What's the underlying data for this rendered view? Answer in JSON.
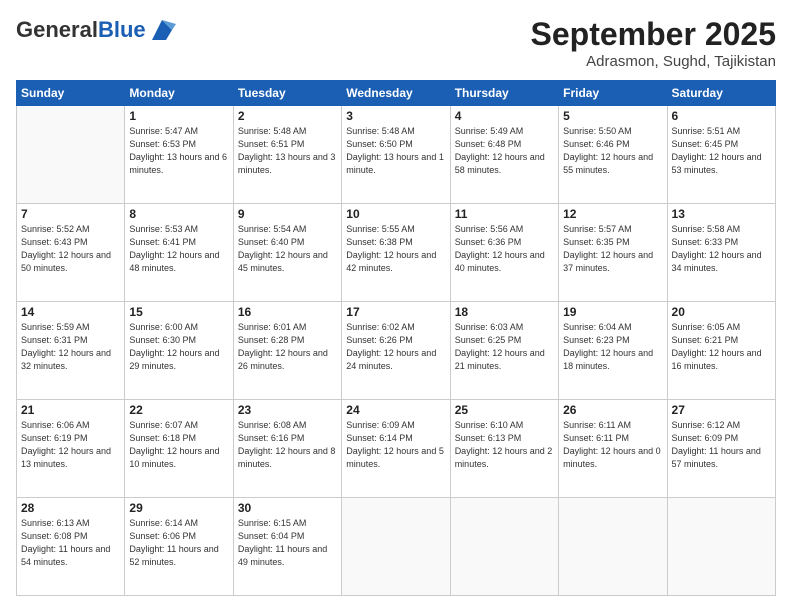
{
  "logo": {
    "general": "General",
    "blue": "Blue"
  },
  "header": {
    "month": "September 2025",
    "location": "Adrasmon, Sughd, Tajikistan"
  },
  "weekdays": [
    "Sunday",
    "Monday",
    "Tuesday",
    "Wednesday",
    "Thursday",
    "Friday",
    "Saturday"
  ],
  "weeks": [
    [
      {
        "day": "",
        "sunrise": "",
        "sunset": "",
        "daylight": ""
      },
      {
        "day": "1",
        "sunrise": "Sunrise: 5:47 AM",
        "sunset": "Sunset: 6:53 PM",
        "daylight": "Daylight: 13 hours and 6 minutes."
      },
      {
        "day": "2",
        "sunrise": "Sunrise: 5:48 AM",
        "sunset": "Sunset: 6:51 PM",
        "daylight": "Daylight: 13 hours and 3 minutes."
      },
      {
        "day": "3",
        "sunrise": "Sunrise: 5:48 AM",
        "sunset": "Sunset: 6:50 PM",
        "daylight": "Daylight: 13 hours and 1 minute."
      },
      {
        "day": "4",
        "sunrise": "Sunrise: 5:49 AM",
        "sunset": "Sunset: 6:48 PM",
        "daylight": "Daylight: 12 hours and 58 minutes."
      },
      {
        "day": "5",
        "sunrise": "Sunrise: 5:50 AM",
        "sunset": "Sunset: 6:46 PM",
        "daylight": "Daylight: 12 hours and 55 minutes."
      },
      {
        "day": "6",
        "sunrise": "Sunrise: 5:51 AM",
        "sunset": "Sunset: 6:45 PM",
        "daylight": "Daylight: 12 hours and 53 minutes."
      }
    ],
    [
      {
        "day": "7",
        "sunrise": "Sunrise: 5:52 AM",
        "sunset": "Sunset: 6:43 PM",
        "daylight": "Daylight: 12 hours and 50 minutes."
      },
      {
        "day": "8",
        "sunrise": "Sunrise: 5:53 AM",
        "sunset": "Sunset: 6:41 PM",
        "daylight": "Daylight: 12 hours and 48 minutes."
      },
      {
        "day": "9",
        "sunrise": "Sunrise: 5:54 AM",
        "sunset": "Sunset: 6:40 PM",
        "daylight": "Daylight: 12 hours and 45 minutes."
      },
      {
        "day": "10",
        "sunrise": "Sunrise: 5:55 AM",
        "sunset": "Sunset: 6:38 PM",
        "daylight": "Daylight: 12 hours and 42 minutes."
      },
      {
        "day": "11",
        "sunrise": "Sunrise: 5:56 AM",
        "sunset": "Sunset: 6:36 PM",
        "daylight": "Daylight: 12 hours and 40 minutes."
      },
      {
        "day": "12",
        "sunrise": "Sunrise: 5:57 AM",
        "sunset": "Sunset: 6:35 PM",
        "daylight": "Daylight: 12 hours and 37 minutes."
      },
      {
        "day": "13",
        "sunrise": "Sunrise: 5:58 AM",
        "sunset": "Sunset: 6:33 PM",
        "daylight": "Daylight: 12 hours and 34 minutes."
      }
    ],
    [
      {
        "day": "14",
        "sunrise": "Sunrise: 5:59 AM",
        "sunset": "Sunset: 6:31 PM",
        "daylight": "Daylight: 12 hours and 32 minutes."
      },
      {
        "day": "15",
        "sunrise": "Sunrise: 6:00 AM",
        "sunset": "Sunset: 6:30 PM",
        "daylight": "Daylight: 12 hours and 29 minutes."
      },
      {
        "day": "16",
        "sunrise": "Sunrise: 6:01 AM",
        "sunset": "Sunset: 6:28 PM",
        "daylight": "Daylight: 12 hours and 26 minutes."
      },
      {
        "day": "17",
        "sunrise": "Sunrise: 6:02 AM",
        "sunset": "Sunset: 6:26 PM",
        "daylight": "Daylight: 12 hours and 24 minutes."
      },
      {
        "day": "18",
        "sunrise": "Sunrise: 6:03 AM",
        "sunset": "Sunset: 6:25 PM",
        "daylight": "Daylight: 12 hours and 21 minutes."
      },
      {
        "day": "19",
        "sunrise": "Sunrise: 6:04 AM",
        "sunset": "Sunset: 6:23 PM",
        "daylight": "Daylight: 12 hours and 18 minutes."
      },
      {
        "day": "20",
        "sunrise": "Sunrise: 6:05 AM",
        "sunset": "Sunset: 6:21 PM",
        "daylight": "Daylight: 12 hours and 16 minutes."
      }
    ],
    [
      {
        "day": "21",
        "sunrise": "Sunrise: 6:06 AM",
        "sunset": "Sunset: 6:19 PM",
        "daylight": "Daylight: 12 hours and 13 minutes."
      },
      {
        "day": "22",
        "sunrise": "Sunrise: 6:07 AM",
        "sunset": "Sunset: 6:18 PM",
        "daylight": "Daylight: 12 hours and 10 minutes."
      },
      {
        "day": "23",
        "sunrise": "Sunrise: 6:08 AM",
        "sunset": "Sunset: 6:16 PM",
        "daylight": "Daylight: 12 hours and 8 minutes."
      },
      {
        "day": "24",
        "sunrise": "Sunrise: 6:09 AM",
        "sunset": "Sunset: 6:14 PM",
        "daylight": "Daylight: 12 hours and 5 minutes."
      },
      {
        "day": "25",
        "sunrise": "Sunrise: 6:10 AM",
        "sunset": "Sunset: 6:13 PM",
        "daylight": "Daylight: 12 hours and 2 minutes."
      },
      {
        "day": "26",
        "sunrise": "Sunrise: 6:11 AM",
        "sunset": "Sunset: 6:11 PM",
        "daylight": "Daylight: 12 hours and 0 minutes."
      },
      {
        "day": "27",
        "sunrise": "Sunrise: 6:12 AM",
        "sunset": "Sunset: 6:09 PM",
        "daylight": "Daylight: 11 hours and 57 minutes."
      }
    ],
    [
      {
        "day": "28",
        "sunrise": "Sunrise: 6:13 AM",
        "sunset": "Sunset: 6:08 PM",
        "daylight": "Daylight: 11 hours and 54 minutes."
      },
      {
        "day": "29",
        "sunrise": "Sunrise: 6:14 AM",
        "sunset": "Sunset: 6:06 PM",
        "daylight": "Daylight: 11 hours and 52 minutes."
      },
      {
        "day": "30",
        "sunrise": "Sunrise: 6:15 AM",
        "sunset": "Sunset: 6:04 PM",
        "daylight": "Daylight: 11 hours and 49 minutes."
      },
      {
        "day": "",
        "sunrise": "",
        "sunset": "",
        "daylight": ""
      },
      {
        "day": "",
        "sunrise": "",
        "sunset": "",
        "daylight": ""
      },
      {
        "day": "",
        "sunrise": "",
        "sunset": "",
        "daylight": ""
      },
      {
        "day": "",
        "sunrise": "",
        "sunset": "",
        "daylight": ""
      }
    ]
  ]
}
